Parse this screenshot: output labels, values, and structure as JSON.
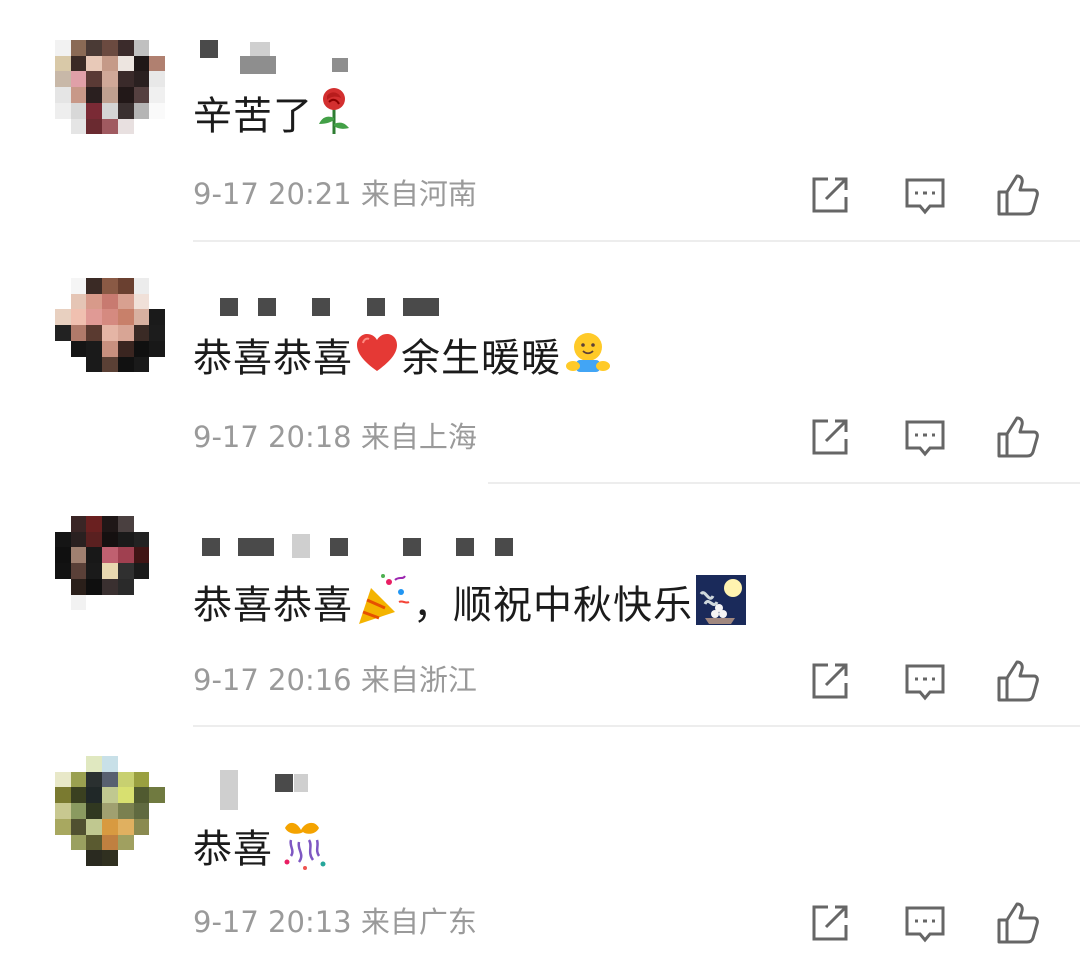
{
  "comments": [
    {
      "text": "辛苦了",
      "emoji": "rose-emoji",
      "date": "9-17",
      "time": "20:21",
      "location": "来自河南"
    },
    {
      "text": "恭喜恭喜",
      "emoji": "red-heart-emoji",
      "text2": "余生暖暖",
      "emoji2": "hug-emoji",
      "date": "9-17",
      "time": "20:18",
      "location": "来自上海"
    },
    {
      "text": "恭喜恭喜",
      "emoji": "party-popper-emoji",
      "text2": "，顺祝中秋快乐",
      "emoji2": "moon-viewing-emoji",
      "date": "9-17",
      "time": "20:16",
      "location": "来自浙江"
    },
    {
      "text": "恭喜",
      "emoji": "confetti-ball-emoji",
      "date": "9-17",
      "time": "20:13",
      "location": "来自广东"
    }
  ],
  "actions": {
    "share_icon": "share-icon",
    "reply_icon": "comment-icon",
    "like_icon": "thumbs-up-icon"
  },
  "colors": {
    "text": "#1b1b1b",
    "meta": "#9a9a9a",
    "icon": "#666666",
    "divider": "#ededed"
  }
}
